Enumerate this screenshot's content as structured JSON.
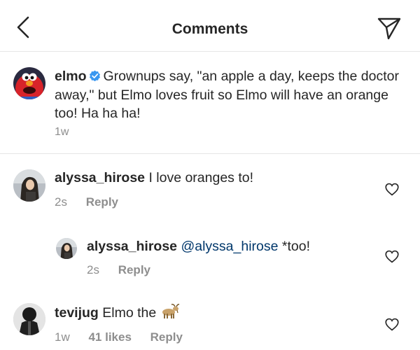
{
  "header": {
    "title": "Comments",
    "back_icon": "chevron-left-icon",
    "share_icon": "paper-plane-icon"
  },
  "caption": {
    "username": "elmo",
    "verified": true,
    "text": "Grownups say, \"an apple a day, keeps the doctor away,\" but Elmo loves fruit so Elmo will have an orange too! Ha ha ha!",
    "time": "1w"
  },
  "comments": [
    {
      "username": "alyssa_hirose",
      "text": "I love oranges to!",
      "time": "2s",
      "reply_label": "Reply"
    },
    {
      "username": "alyssa_hirose",
      "mention": "@alyssa_hirose",
      "text": "*too!",
      "time": "2s",
      "reply_label": "Reply"
    },
    {
      "username": "tevijug",
      "text": "Elmo the",
      "emoji": "goat-emoji",
      "time": "1w",
      "likes": "41 likes",
      "reply_label": "Reply"
    }
  ],
  "colors": {
    "text": "#262626",
    "secondary": "#8e8e8e",
    "mention": "#00376b",
    "verified": "#3897f0",
    "divider": "#e6e6e6"
  }
}
